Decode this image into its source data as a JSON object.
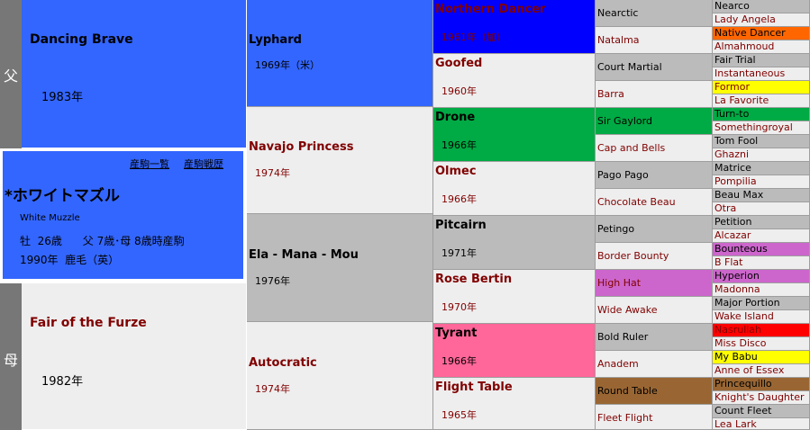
{
  "labels": {
    "sire_side": "父",
    "dam_side": "母"
  },
  "colors": {
    "sire_blue": "#3366ff",
    "gray": "#bbbbbb",
    "light": "#eeeeee",
    "maroon": "#800000",
    "northern_dancer": "#0000ff",
    "green": "#00aa44",
    "pink": "#ff6699",
    "brown": "#996633",
    "purple": "#cc66cc",
    "orange": "#ff6600",
    "yellow": "#ffff00",
    "red": "#ff0000"
  },
  "subject": {
    "links": [
      "産駒一覧",
      "産駒戦歴"
    ],
    "name": "*ホワイトマズル",
    "name_en": "White Muzzle",
    "line1": "牡  26歳      父 7歳･母 8歳時産駒",
    "line2": "1990年  鹿毛（英）"
  },
  "gen1": [
    {
      "name": "Dancing Brave",
      "year": "1983年"
    },
    {
      "name": "Fair of the Furze",
      "year": "1982年"
    }
  ],
  "gen2": [
    {
      "name": "Lyphard",
      "year": "1969年（米）"
    },
    {
      "name": "Navajo Princess",
      "year": "1974年"
    },
    {
      "name": "Ela - Mana - Mou",
      "year": "1976年"
    },
    {
      "name": "Autocratic",
      "year": "1974年"
    }
  ],
  "gen3": [
    {
      "name": "Northern Dancer",
      "year": "1961年（加）",
      "color": "#0000ff"
    },
    {
      "name": "Goofed",
      "year": "1960年",
      "color": "#eeeeee"
    },
    {
      "name": "Drone",
      "year": "1966年",
      "color": "#00aa44"
    },
    {
      "name": "Olmec",
      "year": "1966年",
      "color": "#eeeeee"
    },
    {
      "name": "Pitcairn",
      "year": "1971年",
      "color": "#bbbbbb"
    },
    {
      "name": "Rose Bertin",
      "year": "1970年",
      "color": "#eeeeee"
    },
    {
      "name": "Tyrant",
      "year": "1966年",
      "color": "#ff6699"
    },
    {
      "name": "Flight Table",
      "year": "1965年",
      "color": "#eeeeee"
    }
  ],
  "gen4": [
    {
      "name": "Nearctic",
      "color": "#bbbbbb"
    },
    {
      "name": "Natalma",
      "color": "#eeeeee"
    },
    {
      "name": "Court Martial",
      "color": "#bbbbbb"
    },
    {
      "name": "Barra",
      "color": "#eeeeee"
    },
    {
      "name": "Sir Gaylord",
      "color": "#00aa44"
    },
    {
      "name": "Cap and Bells",
      "color": "#eeeeee"
    },
    {
      "name": "Pago Pago",
      "color": "#bbbbbb"
    },
    {
      "name": "Chocolate Beau",
      "color": "#eeeeee"
    },
    {
      "name": "Petingo",
      "color": "#bbbbbb"
    },
    {
      "name": "Border Bounty",
      "color": "#eeeeee"
    },
    {
      "name": "High Hat",
      "color": "#cc66cc"
    },
    {
      "name": "Wide Awake",
      "color": "#eeeeee"
    },
    {
      "name": "Bold Ruler",
      "color": "#bbbbbb"
    },
    {
      "name": "Anadem",
      "color": "#eeeeee"
    },
    {
      "name": "Round Table",
      "color": "#996633"
    },
    {
      "name": "Fleet Flight",
      "color": "#eeeeee"
    }
  ],
  "gen5": [
    {
      "name": "Nearco",
      "color": "#bbbbbb"
    },
    {
      "name": "Lady Angela",
      "color": "#eeeeee"
    },
    {
      "name": "Native Dancer",
      "color": "#ff6600"
    },
    {
      "name": "Almahmoud",
      "color": "#eeeeee"
    },
    {
      "name": "Fair Trial",
      "color": "#bbbbbb"
    },
    {
      "name": "Instantaneous",
      "color": "#eeeeee"
    },
    {
      "name": "Formor",
      "color": "#ffff00"
    },
    {
      "name": "La Favorite",
      "color": "#eeeeee"
    },
    {
      "name": "Turn-to",
      "color": "#00aa44"
    },
    {
      "name": "Somethingroyal",
      "color": "#eeeeee"
    },
    {
      "name": "Tom Fool",
      "color": "#bbbbbb"
    },
    {
      "name": "Ghazni",
      "color": "#eeeeee"
    },
    {
      "name": "Matrice",
      "color": "#bbbbbb"
    },
    {
      "name": "Pompilia",
      "color": "#eeeeee"
    },
    {
      "name": "Beau Max",
      "color": "#bbbbbb"
    },
    {
      "name": "Otra",
      "color": "#eeeeee"
    },
    {
      "name": "Petition",
      "color": "#bbbbbb"
    },
    {
      "name": "Alcazar",
      "color": "#eeeeee"
    },
    {
      "name": "Bounteous",
      "color": "#cc66cc"
    },
    {
      "name": "B Flat",
      "color": "#eeeeee"
    },
    {
      "name": "Hyperion",
      "color": "#cc66cc"
    },
    {
      "name": "Madonna",
      "color": "#eeeeee"
    },
    {
      "name": "Major Portion",
      "color": "#bbbbbb"
    },
    {
      "name": "Wake Island",
      "color": "#eeeeee"
    },
    {
      "name": "Nasrullah",
      "color": "#ff0000"
    },
    {
      "name": "Miss Disco",
      "color": "#eeeeee"
    },
    {
      "name": "My Babu",
      "color": "#ffff00"
    },
    {
      "name": "Anne of Essex",
      "color": "#eeeeee"
    },
    {
      "name": "Princequillo",
      "color": "#996633"
    },
    {
      "name": "Knight's Daughter",
      "color": "#eeeeee"
    },
    {
      "name": "Count Fleet",
      "color": "#bbbbbb"
    },
    {
      "name": "Lea Lark",
      "color": "#eeeeee"
    }
  ]
}
